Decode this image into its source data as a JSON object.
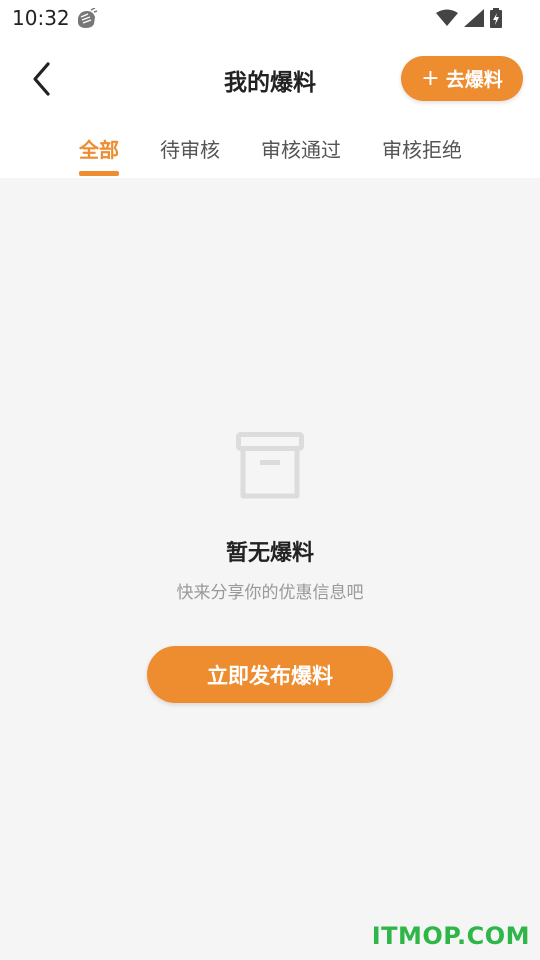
{
  "status_bar": {
    "time": "10:32"
  },
  "header": {
    "title": "我的爆料",
    "action_plus": "+",
    "action_label": "去爆料"
  },
  "tabs": [
    {
      "label": "全部",
      "active": true
    },
    {
      "label": "待审核"
    },
    {
      "label": "审核通过"
    },
    {
      "label": "审核拒绝"
    }
  ],
  "empty_state": {
    "title": "暂无爆料",
    "subtitle": "快来分享你的优惠信息吧",
    "button_label": "立即发布爆料"
  },
  "watermark": "ITMOP.COM",
  "colors": {
    "accent": "#ee8c30",
    "background": "#f5f5f5",
    "watermark": "#2fb648"
  }
}
